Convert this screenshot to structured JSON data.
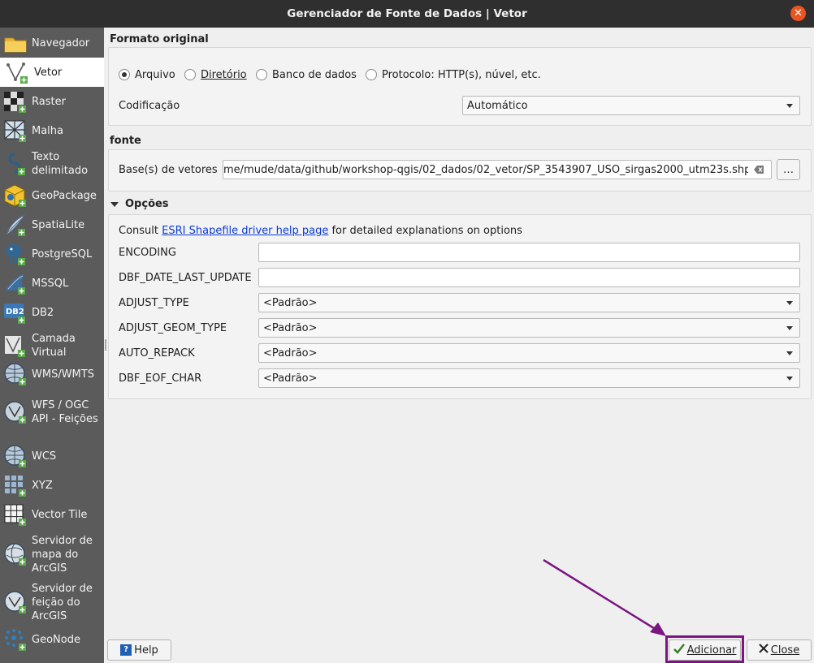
{
  "window": {
    "title": "Gerenciador de Fonte de Dados | Vetor"
  },
  "sidebar": {
    "items": [
      {
        "label": "Navegador",
        "icon": "folder-icon"
      },
      {
        "label": "Vetor",
        "icon": "vector-layer-icon"
      },
      {
        "label": "Raster",
        "icon": "raster-layer-icon"
      },
      {
        "label": "Malha",
        "icon": "mesh-layer-icon"
      },
      {
        "label": "Texto delimitado",
        "icon": "delimited-text-icon"
      },
      {
        "label": "GeoPackage",
        "icon": "geopackage-icon"
      },
      {
        "label": "SpatiaLite",
        "icon": "spatialite-icon"
      },
      {
        "label": "PostgreSQL",
        "icon": "postgresql-icon"
      },
      {
        "label": "MSSQL",
        "icon": "mssql-icon"
      },
      {
        "label": "DB2",
        "icon": "db2-icon"
      },
      {
        "label": "Camada Virtual",
        "icon": "virtual-layer-icon"
      },
      {
        "label": "WMS/WMTS",
        "icon": "wms-globe-icon"
      },
      {
        "label": "WFS / OGC API - Feições",
        "icon": "wfs-globe-icon"
      },
      {
        "label": "WCS",
        "icon": "wcs-globe-icon"
      },
      {
        "label": "XYZ",
        "icon": "xyz-grid-icon"
      },
      {
        "label": "Vector Tile",
        "icon": "vector-tile-icon"
      },
      {
        "label": "Servidor de mapa do ArcGIS",
        "icon": "arcgis-map-server-icon"
      },
      {
        "label": "Servidor de feição do ArcGIS",
        "icon": "arcgis-feature-server-icon"
      },
      {
        "label": "GeoNode",
        "icon": "geonode-icon"
      }
    ],
    "selected": "Vetor"
  },
  "source_type": {
    "heading": "Formato original",
    "options": [
      "Arquivo",
      "Diretório",
      "Banco de dados",
      "Protocolo: HTTP(s), núvel, etc."
    ],
    "selected": "Arquivo",
    "encoding_label": "Codificação",
    "encoding_value": "Automático"
  },
  "source": {
    "heading": "fonte",
    "label": "Base(s) de vetores",
    "path": "me/mude/data/github/workshop-qgis/02_dados/02_vetor/SP_3543907_USO_sirgas2000_utm23s.shp",
    "browse_label": "…"
  },
  "options": {
    "heading": "Opções",
    "consult_prefix": "Consult",
    "link_text": "ESRI Shapefile driver help page",
    "consult_suffix": "for detailed explanations on options",
    "fields": [
      {
        "name": "ENCODING",
        "type": "text",
        "value": ""
      },
      {
        "name": "DBF_DATE_LAST_UPDATE",
        "type": "text",
        "value": ""
      },
      {
        "name": "ADJUST_TYPE",
        "type": "select",
        "value": "<Padrão>"
      },
      {
        "name": "ADJUST_GEOM_TYPE",
        "type": "select",
        "value": "<Padrão>"
      },
      {
        "name": "AUTO_REPACK",
        "type": "select",
        "value": "<Padrão>"
      },
      {
        "name": "DBF_EOF_CHAR",
        "type": "select",
        "value": "<Padrão>"
      }
    ]
  },
  "buttons": {
    "help": "Help",
    "add": "Adicionar",
    "close": "Close"
  },
  "annotation": {
    "color": "#7b1580"
  }
}
